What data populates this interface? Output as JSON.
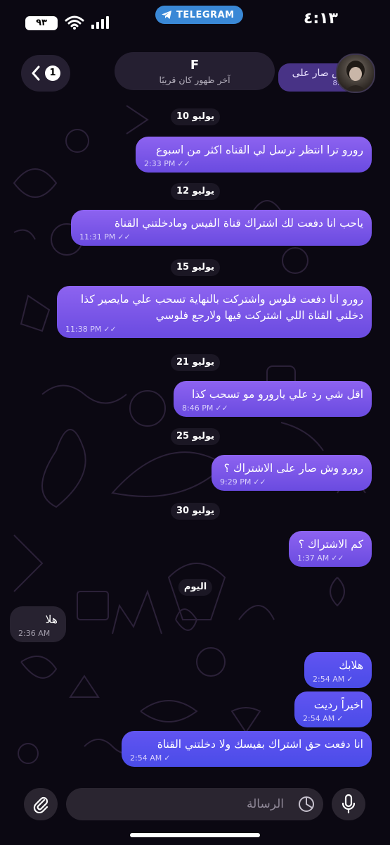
{
  "status_bar": {
    "time": "٤:١٣",
    "battery": "٩٣",
    "app_pill": "TELEGRAM"
  },
  "header": {
    "name": "F",
    "status": "آخر ظهور كان قريبًا",
    "back_count": "1",
    "pinned_preview_text": "وش صار على",
    "pinned_preview_time": "8:26"
  },
  "messages": [
    {
      "type": "date",
      "text": "10 يوليو"
    },
    {
      "type": "out",
      "text": "رورو ترا انتظر ترسل لي القناه اكثر من اسبوع",
      "time": "2:33 PM"
    },
    {
      "type": "date",
      "text": "12 يوليو"
    },
    {
      "type": "out",
      "text": "ياحب انا دفعت لك اشتراك قناة الفيس ومادخلتني القناة",
      "time": "11:31 PM"
    },
    {
      "type": "date",
      "text": "15 يوليو"
    },
    {
      "type": "out",
      "text": "رورو انا دفعت فلوس واشتركت بالنهاية تسحب علي مايصير كذا دخلني القناة اللي اشتركت فيها ولارجع فلوسي",
      "time": "11:38 PM"
    },
    {
      "type": "date",
      "text": "21 يوليو"
    },
    {
      "type": "out",
      "text": "اقل شي رد علي يارورو مو تسحب كذا",
      "time": "8:46 PM"
    },
    {
      "type": "date",
      "text": "25 يوليو"
    },
    {
      "type": "out",
      "text": "رورو وش صار على الاشتراك ؟",
      "time": "9:29 PM"
    },
    {
      "type": "date",
      "text": "30 يوليو"
    },
    {
      "type": "out",
      "text": "كم الاشتراك ؟",
      "time": "1:37 AM"
    },
    {
      "type": "date",
      "text": "اليوم"
    },
    {
      "type": "in",
      "text": "هلا",
      "time": "2:36 AM"
    },
    {
      "type": "out",
      "text": "هلابك",
      "time": "2:54 AM"
    },
    {
      "type": "out",
      "text": "اخيراً رديت",
      "time": "2:54 AM"
    },
    {
      "type": "out",
      "text": "انا دفعت حق اشتراك بفيسك ولا دخلتني القناة",
      "time": "2:54 AM"
    }
  ],
  "input": {
    "placeholder": "الرسالة"
  },
  "icons": {
    "back": "chevron-left-icon",
    "attach": "paperclip-icon",
    "sticker": "clock-sticker-icon",
    "mic": "microphone-icon",
    "telegram": "telegram-plane-icon"
  },
  "colors": {
    "outgoing_bubble": "#7b55ea",
    "outgoing_bubble_recent": "#5650ee",
    "incoming_bubble": "#272230",
    "background": "#0b0812",
    "telegram_pill": "#3a88d6"
  }
}
